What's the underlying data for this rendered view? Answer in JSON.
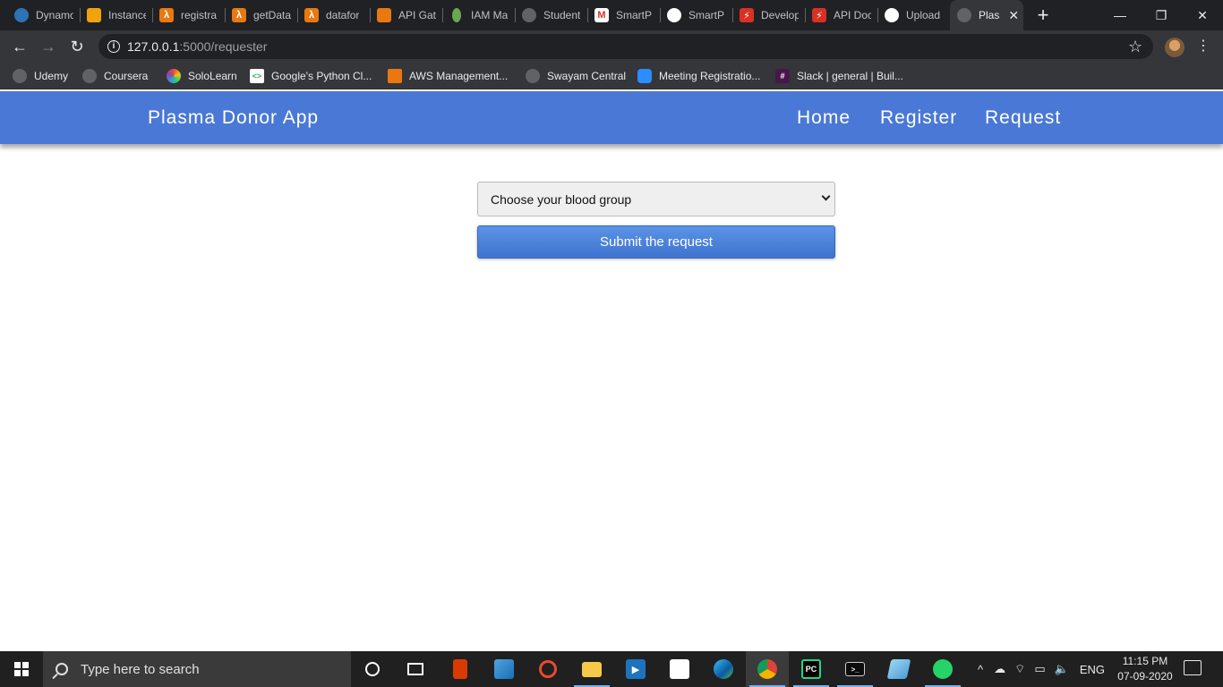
{
  "browser": {
    "tabs": [
      {
        "title": "Dynamo",
        "icon": "dynamodb-icon",
        "color": "#2e73b8"
      },
      {
        "title": "Instance",
        "icon": "aws-box-icon",
        "color": "#f0a30a"
      },
      {
        "title": "registra",
        "icon": "lambda-icon",
        "color": "#e8780f"
      },
      {
        "title": "getData",
        "icon": "lambda-icon",
        "color": "#e8780f"
      },
      {
        "title": "datafor",
        "icon": "lambda-icon",
        "color": "#e8780f"
      },
      {
        "title": "API Gat",
        "icon": "api-gateway-icon",
        "color": "#e8780f"
      },
      {
        "title": "IAM Ma",
        "icon": "iam-key-icon",
        "color": "#6aa84f"
      },
      {
        "title": "Student",
        "icon": "globe-icon",
        "color": "#5f6368"
      },
      {
        "title": "SmartP",
        "icon": "gmail-icon",
        "color": "#d93025"
      },
      {
        "title": "SmartP",
        "icon": "github-icon",
        "color": "#ffffff"
      },
      {
        "title": "Develop",
        "icon": "api-doc-icon",
        "color": "#d93025"
      },
      {
        "title": "API Doc",
        "icon": "api-doc-icon",
        "color": "#d93025"
      },
      {
        "title": "Upload",
        "icon": "github-icon",
        "color": "#ffffff"
      },
      {
        "title": "Plas",
        "icon": "globe-icon",
        "color": "#5f6368",
        "active": true
      }
    ],
    "new_tab": "+",
    "window_controls": {
      "minimize": "—",
      "restore": "❐",
      "close": "✕"
    },
    "url_host": "127.0.0.1",
    "url_path": ":5000/requester",
    "bookmarks": [
      {
        "label": "Udemy",
        "icon": "globe-icon",
        "color": "#5f6368"
      },
      {
        "label": "Coursera",
        "icon": "globe-icon",
        "color": "#5f6368"
      },
      {
        "label": "SoloLearn",
        "icon": "sololearn-icon",
        "color": "#8e44ad"
      },
      {
        "label": "Google's Python Cl...",
        "icon": "google-dev-icon",
        "color": "#ffffff"
      },
      {
        "label": "AWS Management...",
        "icon": "aws-box-icon",
        "color": "#e8780f"
      },
      {
        "label": "Swayam Central",
        "icon": "globe-icon",
        "color": "#5f6368"
      },
      {
        "label": "Meeting Registratio...",
        "icon": "zoom-icon",
        "color": "#2d8cff"
      },
      {
        "label": "Slack | general | Buil...",
        "icon": "slack-icon",
        "color": "#4a154b"
      }
    ]
  },
  "app": {
    "brand": "Plasma Donor App",
    "nav": [
      "Home",
      "Register",
      "Request"
    ],
    "blood_group_select": "Choose your blood group",
    "submit_label": "Submit the request",
    "accent_color": "#4a78d6"
  },
  "taskbar": {
    "search_placeholder": "Type here to search",
    "apps": [
      {
        "name": "cortana-icon"
      },
      {
        "name": "task-view-icon"
      },
      {
        "name": "office-icon"
      },
      {
        "name": "photos-icon"
      },
      {
        "name": "groove-music-icon"
      },
      {
        "name": "file-explorer-icon"
      },
      {
        "name": "movies-tv-icon"
      },
      {
        "name": "store-icon"
      },
      {
        "name": "edge-icon"
      },
      {
        "name": "chrome-icon"
      },
      {
        "name": "pycharm-icon"
      },
      {
        "name": "terminal-icon"
      },
      {
        "name": "notepad-icon"
      },
      {
        "name": "whatsapp-icon"
      }
    ],
    "language": "ENG",
    "time": "11:15 PM",
    "date": "07-09-2020"
  }
}
